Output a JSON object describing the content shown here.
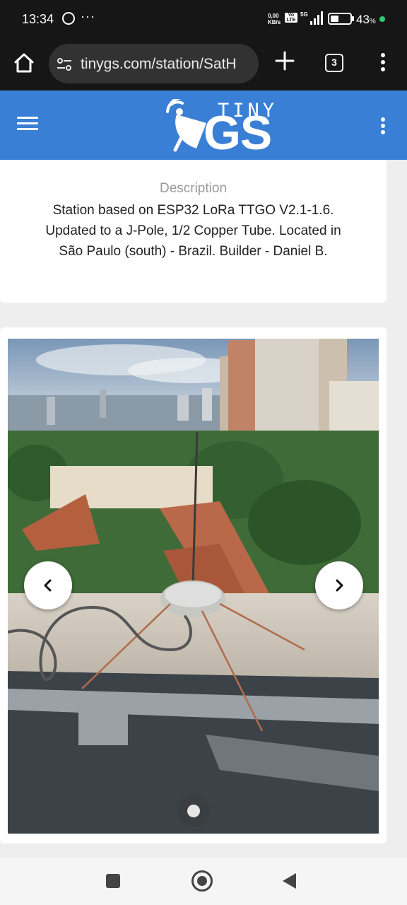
{
  "status_bar": {
    "time": "13:34",
    "network_speed": "0,00 KB/s",
    "volte": "Vo LTE",
    "network_type": "5G",
    "battery_percent": "43",
    "battery_level": 0.43,
    "icons": [
      "whatsapp-icon",
      "more-notifications-icon",
      "signal-icon",
      "battery-icon",
      "charging-dot-icon"
    ]
  },
  "browser": {
    "url": "tinygs.com/station/SatH",
    "tab_count": "3",
    "icons": [
      "home-icon",
      "site-settings-icon",
      "new-tab-plus-icon",
      "tab-switcher-icon",
      "browser-menu-icon"
    ]
  },
  "app_header": {
    "logo_top": "TINY",
    "logo_main": "GS",
    "accent_color": "#3a7fd6",
    "icons": [
      "hamburger-menu-icon",
      "satellite-dish-logo-icon",
      "overflow-menu-icon"
    ]
  },
  "description": {
    "title": "Description",
    "text": "Station based on ESP32 LoRa TTGO V2.1-1.6. Updated to a J-Pole, 1/2 Copper Tube. Located in São Paulo (south) - Brazil. Builder - Daniel B."
  },
  "gallery": {
    "photo_subject": "antenna-photo",
    "current_slide": 1,
    "total_slides": 1,
    "icons": [
      "chevron-left-icon",
      "chevron-right-icon"
    ]
  },
  "nav_bar": {
    "icons": [
      "recents-square-icon",
      "home-circle-icon",
      "back-triangle-icon"
    ]
  }
}
